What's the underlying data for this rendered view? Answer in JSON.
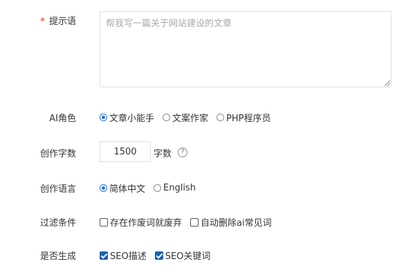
{
  "prompt": {
    "required_mark": "*",
    "label": "提示语",
    "placeholder": "帮我写一篇关于网站建设的文章",
    "value": ""
  },
  "ai_role": {
    "label": "AI角色",
    "options": [
      {
        "label": "文章小能手",
        "selected": true
      },
      {
        "label": "文案作家",
        "selected": false
      },
      {
        "label": "PHP程序员",
        "selected": false
      }
    ]
  },
  "word_count": {
    "label": "创作字数",
    "value": "1500",
    "unit": "字数",
    "help_icon": "question-circle-icon",
    "help_glyph": "?"
  },
  "language": {
    "label": "创作语言",
    "options": [
      {
        "label": "简体中文",
        "selected": true
      },
      {
        "label": "English",
        "selected": false
      }
    ]
  },
  "filters": {
    "label": "过滤条件",
    "options": [
      {
        "label": "存在作废词就废弃",
        "checked": false
      },
      {
        "label": "自动删除ai常见词",
        "checked": false
      }
    ]
  },
  "generate": {
    "label": "是否生成",
    "options": [
      {
        "label": "SEO描述",
        "checked": true
      },
      {
        "label": "SEO关键词",
        "checked": true
      }
    ]
  },
  "colors": {
    "required": "#f56c2d",
    "radio_accent": "#1a73e8",
    "checkbox_accent": "#1a5fb4"
  }
}
